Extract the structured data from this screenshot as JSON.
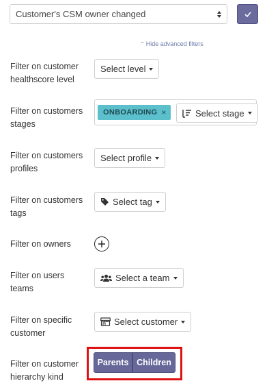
{
  "event_select": {
    "value": "Customer's CSM owner changed"
  },
  "confirm_button": {
    "icon": "check-icon"
  },
  "hide_advanced": {
    "label": "Hide advanced filters",
    "icon": "caret-up-icon"
  },
  "filters": {
    "healthscore": {
      "label": "Filter on customer healthscore level",
      "button": "Select level"
    },
    "stages": {
      "label": "Filter on customers stages",
      "tag": "ONBOARDING",
      "tag_remove": "×",
      "button": "Select stage",
      "icon": "sort-icon"
    },
    "profiles": {
      "label": "Filter on customers profiles",
      "button": "Select profile"
    },
    "tags": {
      "label": "Filter on customers tags",
      "button": "Select tag",
      "icon": "tag-icon"
    },
    "owners": {
      "label": "Filter on owners",
      "icon": "add-circle-icon"
    },
    "teams": {
      "label": "Filter on users teams",
      "button": "Select a team",
      "icon": "users-icon"
    },
    "customer": {
      "label": "Filter on specific customer",
      "button": "Select customer",
      "icon": "store-icon"
    },
    "hierarchy": {
      "label": "Filter on customer hierarchy kind",
      "options": [
        "Parents",
        "Children"
      ]
    }
  },
  "colors": {
    "accent": "#67679a",
    "tag": "#5bc0cc",
    "highlight": "#e01010",
    "link": "#6b7aa8"
  }
}
